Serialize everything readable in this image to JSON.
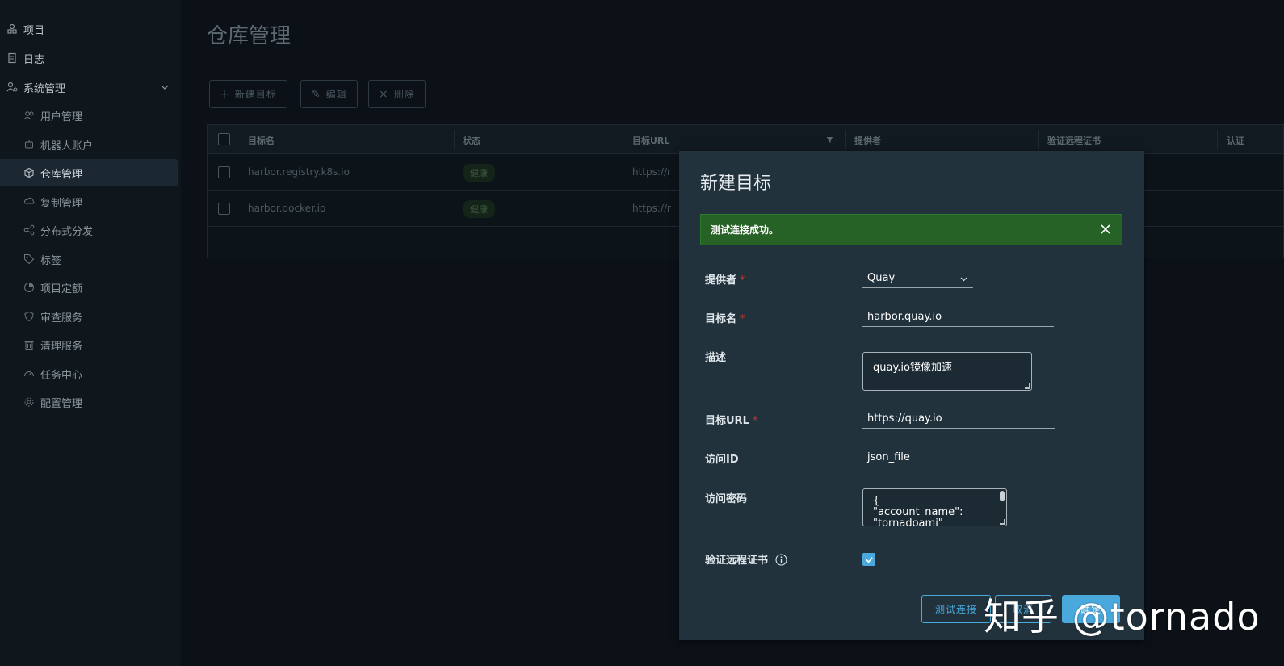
{
  "sidebar": {
    "items": [
      {
        "label": "项目",
        "icon": "project-icon"
      },
      {
        "label": "日志",
        "icon": "log-icon"
      },
      {
        "label": "系统管理",
        "icon": "admin-icon"
      }
    ],
    "subitems": [
      {
        "label": "用户管理",
        "icon": "users-icon"
      },
      {
        "label": "机器人账户",
        "icon": "robot-icon"
      },
      {
        "label": "仓库管理",
        "icon": "registry-icon"
      },
      {
        "label": "复制管理",
        "icon": "replication-icon"
      },
      {
        "label": "分布式分发",
        "icon": "share-icon"
      },
      {
        "label": "标签",
        "icon": "tag-icon"
      },
      {
        "label": "项目定额",
        "icon": "quota-icon"
      },
      {
        "label": "审查服务",
        "icon": "shield-icon"
      },
      {
        "label": "清理服务",
        "icon": "trash-icon"
      },
      {
        "label": "任务中心",
        "icon": "dashboard-icon"
      },
      {
        "label": "配置管理",
        "icon": "gear-icon"
      }
    ]
  },
  "page": {
    "title": "仓库管理",
    "toolbar": {
      "new": "新建目标",
      "edit": "编辑",
      "delete": "删除"
    }
  },
  "table": {
    "headers": [
      "目标名",
      "状态",
      "目标URL",
      "提供者",
      "验证远程证书",
      "认证"
    ],
    "rows": [
      {
        "name": "harbor.registry.k8s.io",
        "status": "健康",
        "url": "https://r"
      },
      {
        "name": "harbor.docker.io",
        "status": "健康",
        "url": "https://r"
      }
    ]
  },
  "modal": {
    "title": "新建目标",
    "alert": "测试连接成功。",
    "fields": {
      "provider": {
        "label": "提供者",
        "value": "Quay"
      },
      "name": {
        "label": "目标名",
        "value": "harbor.quay.io"
      },
      "desc": {
        "label": "描述",
        "value": "quay.io镜像加速"
      },
      "url": {
        "label": "目标URL",
        "value": "https://quay.io"
      },
      "access_id": {
        "label": "访问ID",
        "value": "json_file"
      },
      "access_secret": {
        "label": "访问密码",
        "value": "{\n\"account_name\":\n\"tornadoami\""
      },
      "verify": {
        "label": "验证远程证书",
        "checked": true
      }
    },
    "buttons": {
      "test": "测试连接",
      "cancel": "取消",
      "ok": "确定"
    }
  },
  "watermark": "知乎 @tornado",
  "colors": {
    "accent": "#49a8dc",
    "success": "#266125",
    "modal_bg": "#21323d",
    "page_bg": "#0b1117"
  }
}
